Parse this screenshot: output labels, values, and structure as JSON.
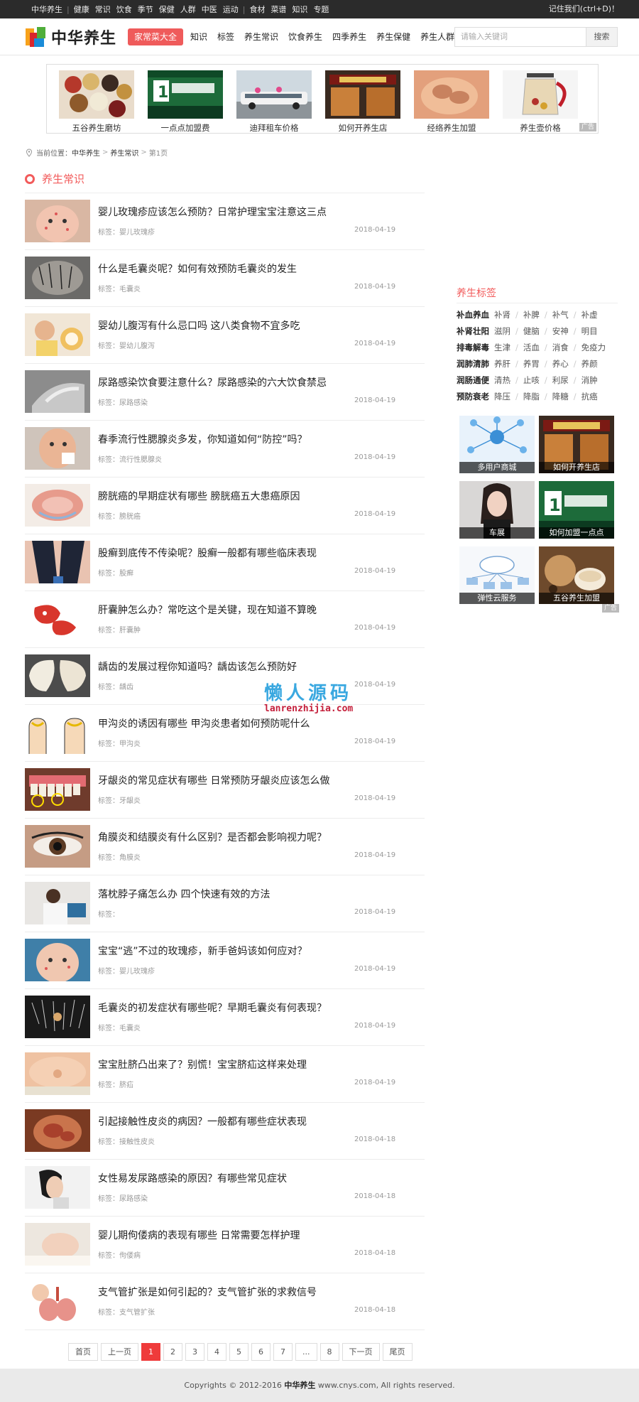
{
  "topbar": {
    "links": [
      "中华养生",
      "健康",
      "常识",
      "饮食",
      "季节",
      "保健",
      "人群",
      "中医",
      "运动",
      "食材",
      "菜谱",
      "知识",
      "专题"
    ],
    "right": "记住我们(ctrl+D)！"
  },
  "header": {
    "logo_text": "中华养生",
    "hot_button": "家常菜大全",
    "nav": [
      "知识",
      "标签",
      "养生常识",
      "饮食养生",
      "四季养生",
      "养生保健",
      "养生人群"
    ],
    "search_placeholder": "请输入关键词",
    "search_button": "搜索"
  },
  "top_ads": {
    "items": [
      "五谷养生磨坊",
      "一点点加盟费",
      "迪拜租车价格",
      "如何开养生店",
      "经络养生加盟",
      "养生壶价格"
    ],
    "ad_tag": "广告"
  },
  "breadcrumb": {
    "prefix": "当前位置：",
    "items": [
      "中华养生",
      "养生常识",
      "第1页"
    ]
  },
  "section_title": "养生常识",
  "articles": [
    {
      "title": "婴儿玫瑰疹应该怎么预防？日常护理宝宝注意这三点",
      "tag": "标签：婴儿玫瑰疹",
      "date": "2018-04-19"
    },
    {
      "title": "什么是毛囊炎呢？如何有效预防毛囊炎的发生",
      "tag": "标签：毛囊炎",
      "date": "2018-04-19"
    },
    {
      "title": "婴幼儿腹泻有什么忌口吗 这八类食物不宜多吃",
      "tag": "标签：婴幼儿腹泻",
      "date": "2018-04-19"
    },
    {
      "title": "尿路感染饮食要注意什么？尿路感染的六大饮食禁忌",
      "tag": "标签：尿路感染",
      "date": "2018-04-19"
    },
    {
      "title": "春季流行性腮腺炎多发，你知道如何“防控”吗？",
      "tag": "标签：流行性腮腺炎",
      "date": "2018-04-19"
    },
    {
      "title": "膀胱癌的早期症状有哪些 膀胱癌五大患癌原因",
      "tag": "标签：膀胱癌",
      "date": "2018-04-19"
    },
    {
      "title": "股癣到底传不传染呢？股癣一般都有哪些临床表现",
      "tag": "标签：股癣",
      "date": "2018-04-19"
    },
    {
      "title": "肝囊肿怎么办？常吃这个是关键，现在知道不算晚",
      "tag": "标签：肝囊肿",
      "date": "2018-04-19"
    },
    {
      "title": "龋齿的发展过程你知道吗？龋齿该怎么预防好",
      "tag": "标签：龋齿",
      "date": "2018-04-19"
    },
    {
      "title": "甲沟炎的诱因有哪些 甲沟炎患者如何预防呢什么",
      "tag": "标签：甲沟炎",
      "date": "2018-04-19"
    },
    {
      "title": "牙龈炎的常见症状有哪些 日常预防牙龈炎应该怎么做",
      "tag": "标签：牙龈炎",
      "date": "2018-04-19"
    },
    {
      "title": "角膜炎和结膜炎有什么区别？是否都会影响视力呢？",
      "tag": "标签：角膜炎",
      "date": "2018-04-19"
    },
    {
      "title": "落枕脖子痛怎么办 四个快速有效的方法",
      "tag": "标签：",
      "date": "2018-04-19"
    },
    {
      "title": "宝宝“逃”不过的玫瑰疹，新手爸妈该如何应对？",
      "tag": "标签：婴儿玫瑰疹",
      "date": "2018-04-19"
    },
    {
      "title": "毛囊炎的初发症状有哪些呢？早期毛囊炎有何表现？",
      "tag": "标签：毛囊炎",
      "date": "2018-04-19"
    },
    {
      "title": "宝宝肚脐凸出来了？别慌！宝宝脐疝这样来处理",
      "tag": "标签：脐疝",
      "date": "2018-04-19"
    },
    {
      "title": "引起接触性皮炎的病因？一般都有哪些症状表现",
      "tag": "标签：接触性皮炎",
      "date": "2018-04-18"
    },
    {
      "title": "女性易发尿路感染的原因？有哪些常见症状",
      "tag": "标签：尿路感染",
      "date": "2018-04-18"
    },
    {
      "title": "婴儿期佝偻病的表现有哪些 日常需要怎样护理",
      "tag": "标签：佝偻病",
      "date": "2018-04-18"
    },
    {
      "title": "支气管扩张是如何引起的？支气管扩张的求救信号",
      "tag": "标签：支气管扩张",
      "date": "2018-04-18"
    }
  ],
  "pagination": [
    "首页",
    "上一页",
    "1",
    "2",
    "3",
    "4",
    "5",
    "6",
    "7",
    "...",
    "8",
    "下一页",
    "尾页"
  ],
  "sidebar": {
    "title": "养生标签",
    "rows": [
      {
        "head": "补血养血",
        "tags": [
          "补肾",
          "补脾",
          "补气",
          "补虚"
        ]
      },
      {
        "head": "补肾壮阳",
        "tags": [
          "滋阴",
          "健脑",
          "安神",
          "明目"
        ]
      },
      {
        "head": "排毒解毒",
        "tags": [
          "生津",
          "活血",
          "消食",
          "免疫力"
        ]
      },
      {
        "head": "润肺清肺",
        "tags": [
          "养肝",
          "养胃",
          "养心",
          "养颜"
        ]
      },
      {
        "head": "润肠通便",
        "tags": [
          "清热",
          "止咳",
          "利尿",
          "消肿"
        ]
      },
      {
        "head": "预防衰老",
        "tags": [
          "降压",
          "降脂",
          "降糖",
          "抗癌"
        ]
      }
    ],
    "ads": [
      "多用户商城",
      "如何开养生店",
      "车展",
      "如何加盟一点点",
      "弹性云服务",
      "五谷养生加盟"
    ],
    "ad_tag": "广告"
  },
  "watermark": {
    "cn": "懒人源码",
    "en": "lanrenzhijia.com"
  },
  "footer": {
    "prefix": "Copyrights © 2012-2016 ",
    "site": "中华养生",
    "suffix": " www.cnys.com, All rights reserved."
  }
}
